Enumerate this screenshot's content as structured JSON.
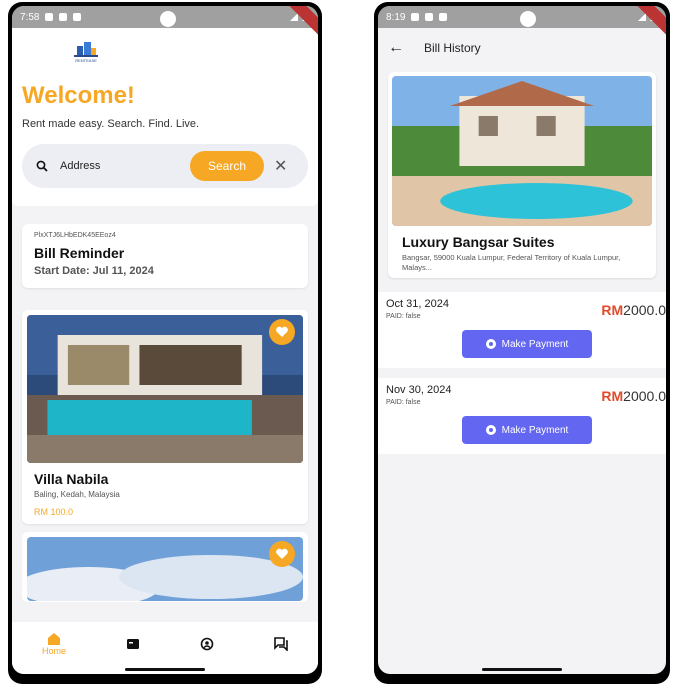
{
  "left": {
    "status": {
      "time": "7:58"
    },
    "header": {
      "logo_text": "RENTEASE",
      "welcome": "Welcome!",
      "tagline": "Rent made easy. Search. Find. Live.",
      "search_value": "Address",
      "search_button": "Search",
      "clear_glyph": "✕"
    },
    "bill_reminder": {
      "id": "PlxXTJ6LHbEDK45EEoz4",
      "title": "Bill Reminder",
      "start_date": "Start Date: Jul 11, 2024"
    },
    "properties": [
      {
        "name": "Villa Nabila",
        "location": "Baling, Kedah, Malaysia",
        "price": "RM 100.0"
      }
    ],
    "nav": {
      "home_label": "Home"
    }
  },
  "right": {
    "status": {
      "time": "8:19"
    },
    "appbar": {
      "back_glyph": "←",
      "title": "Bill History"
    },
    "property": {
      "name": "Luxury Bangsar Suites",
      "location": "Bangsar, 59000 Kuala Lumpur, Federal Territory of Kuala Lumpur, Malays..."
    },
    "bills": [
      {
        "date": "Oct 31, 2024",
        "paid": "PAID: false",
        "currency": "RM",
        "amount": "2000.0",
        "button": "Make Payment"
      },
      {
        "date": "Nov 30, 2024",
        "paid": "PAID: false",
        "currency": "RM",
        "amount": "2000.0",
        "button": "Make Payment"
      }
    ]
  },
  "colors": {
    "accent": "#f6a723",
    "button": "#6366f1",
    "currency": "#e04b2b"
  },
  "icons": [
    "search-icon",
    "close-icon",
    "heart-icon",
    "home-icon",
    "card-icon",
    "profile-icon",
    "chat-icon",
    "back-arrow-icon",
    "coin-icon"
  ]
}
